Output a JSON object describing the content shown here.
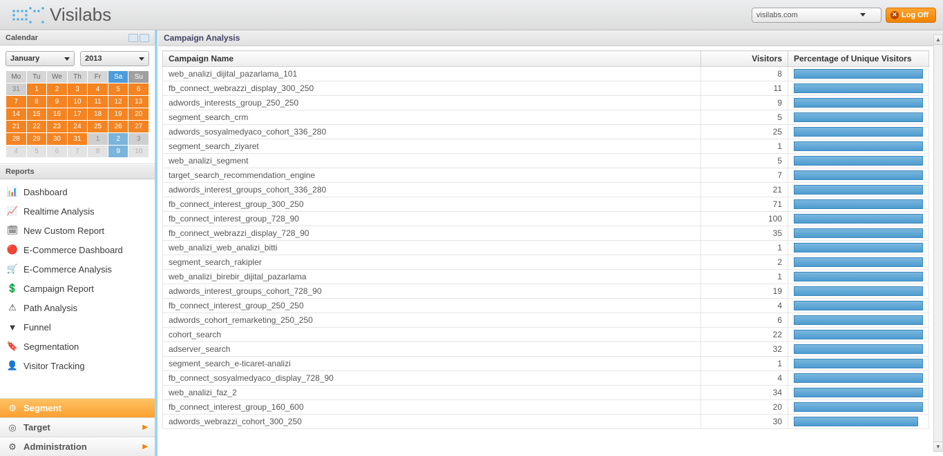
{
  "header": {
    "logo_text": "Visilabs",
    "domain": "visilabs.com",
    "logoff": "Log Off"
  },
  "sidebar": {
    "calendar_title": "Calendar",
    "month": "January",
    "year": "2013",
    "weekdays": [
      "Mo",
      "Tu",
      "We",
      "Th",
      "Fr",
      "Sa",
      "Su"
    ],
    "weeks": [
      [
        {
          "d": "31",
          "c": "gray"
        },
        {
          "d": "1",
          "c": "orange"
        },
        {
          "d": "2",
          "c": "orange"
        },
        {
          "d": "3",
          "c": "orange"
        },
        {
          "d": "4",
          "c": "orange"
        },
        {
          "d": "5",
          "c": "orange"
        },
        {
          "d": "6",
          "c": "orange"
        }
      ],
      [
        {
          "d": "7",
          "c": "orange"
        },
        {
          "d": "8",
          "c": "orange"
        },
        {
          "d": "9",
          "c": "orange"
        },
        {
          "d": "10",
          "c": "orange"
        },
        {
          "d": "11",
          "c": "orange"
        },
        {
          "d": "12",
          "c": "orange"
        },
        {
          "d": "13",
          "c": "orange"
        }
      ],
      [
        {
          "d": "14",
          "c": "orange"
        },
        {
          "d": "15",
          "c": "orange"
        },
        {
          "d": "16",
          "c": "orange"
        },
        {
          "d": "17",
          "c": "orange"
        },
        {
          "d": "18",
          "c": "orange"
        },
        {
          "d": "19",
          "c": "orange"
        },
        {
          "d": "20",
          "c": "orange"
        }
      ],
      [
        {
          "d": "21",
          "c": "orange"
        },
        {
          "d": "22",
          "c": "orange"
        },
        {
          "d": "23",
          "c": "orange"
        },
        {
          "d": "24",
          "c": "orange"
        },
        {
          "d": "25",
          "c": "orange"
        },
        {
          "d": "26",
          "c": "orange"
        },
        {
          "d": "27",
          "c": "orange"
        }
      ],
      [
        {
          "d": "28",
          "c": "orange"
        },
        {
          "d": "29",
          "c": "orange"
        },
        {
          "d": "30",
          "c": "orange"
        },
        {
          "d": "31",
          "c": "orange"
        },
        {
          "d": "1",
          "c": "gray"
        },
        {
          "d": "2",
          "c": "blue"
        },
        {
          "d": "3",
          "c": "gray"
        }
      ],
      [
        {
          "d": "4",
          "c": "faint"
        },
        {
          "d": "5",
          "c": "faint"
        },
        {
          "d": "6",
          "c": "faint"
        },
        {
          "d": "7",
          "c": "faint"
        },
        {
          "d": "8",
          "c": "faint"
        },
        {
          "d": "9",
          "c": "blue"
        },
        {
          "d": "10",
          "c": "faint"
        }
      ]
    ],
    "reports_title": "Reports",
    "reports": [
      {
        "label": "Dashboard",
        "icon": "bar-chart-icon"
      },
      {
        "label": "Realtime Analysis",
        "icon": "line-chart-icon"
      },
      {
        "label": "New Custom Report",
        "icon": "calendar-icon"
      },
      {
        "label": "E-Commerce Dashboard",
        "icon": "globe-icon"
      },
      {
        "label": "E-Commerce Analysis",
        "icon": "cart-icon"
      },
      {
        "label": "Campaign Report",
        "icon": "dollar-icon"
      },
      {
        "label": "Path Analysis",
        "icon": "warning-icon"
      },
      {
        "label": "Funnel",
        "icon": "funnel-icon"
      },
      {
        "label": "Segmentation",
        "icon": "tag-icon"
      },
      {
        "label": "Visitor Tracking",
        "icon": "user-icon"
      }
    ],
    "bottom": [
      {
        "label": "Segment",
        "icon": "gear-icon",
        "active": true,
        "arrow": false
      },
      {
        "label": "Target",
        "icon": "target-icon",
        "active": false,
        "arrow": true
      },
      {
        "label": "Administration",
        "icon": "admin-icon",
        "active": false,
        "arrow": true
      }
    ]
  },
  "main": {
    "title": "Campaign Analysis",
    "columns": {
      "name": "Campaign Name",
      "visitors": "Visitors",
      "percent": "Percentage of Unique Visitors"
    },
    "rows": [
      {
        "name": "web_analizi_dijital_pazarlama_101",
        "visitors": 8,
        "pct": 100
      },
      {
        "name": "fb_connect_webrazzi_display_300_250",
        "visitors": 11,
        "pct": 100
      },
      {
        "name": "adwords_interests_group_250_250",
        "visitors": 9,
        "pct": 100
      },
      {
        "name": "segment_search_crm",
        "visitors": 5,
        "pct": 100
      },
      {
        "name": "adwords_sosyalmedyaco_cohort_336_280",
        "visitors": 25,
        "pct": 100
      },
      {
        "name": "segment_search_ziyaret",
        "visitors": 1,
        "pct": 100
      },
      {
        "name": "web_analizi_segment",
        "visitors": 5,
        "pct": 100
      },
      {
        "name": "target_search_recommendation_engine",
        "visitors": 7,
        "pct": 100
      },
      {
        "name": "adwords_interest_groups_cohort_336_280",
        "visitors": 21,
        "pct": 100
      },
      {
        "name": "fb_connect_interest_group_300_250",
        "visitors": 71,
        "pct": 100
      },
      {
        "name": "fb_connect_interest_group_728_90",
        "visitors": 100,
        "pct": 100
      },
      {
        "name": "fb_connect_webrazzi_display_728_90",
        "visitors": 35,
        "pct": 100
      },
      {
        "name": "web_analizi_web_analizi_bitti",
        "visitors": 1,
        "pct": 100
      },
      {
        "name": "segment_search_rakipler",
        "visitors": 2,
        "pct": 100
      },
      {
        "name": "web_analizi_birebir_dijital_pazarlama",
        "visitors": 1,
        "pct": 100
      },
      {
        "name": "adwords_interest_groups_cohort_728_90",
        "visitors": 19,
        "pct": 100
      },
      {
        "name": "fb_connect_interest_group_250_250",
        "visitors": 4,
        "pct": 100
      },
      {
        "name": "adwords_cohort_remarketing_250_250",
        "visitors": 6,
        "pct": 100
      },
      {
        "name": "cohort_search",
        "visitors": 22,
        "pct": 100
      },
      {
        "name": "adserver_search",
        "visitors": 32,
        "pct": 100
      },
      {
        "name": "segment_search_e-ticaret-analizi",
        "visitors": 1,
        "pct": 100
      },
      {
        "name": "fb_connect_sosyalmedyaco_display_728_90",
        "visitors": 4,
        "pct": 100
      },
      {
        "name": "web_analizi_faz_2",
        "visitors": 34,
        "pct": 100
      },
      {
        "name": "fb_connect_interest_group_160_600",
        "visitors": 20,
        "pct": 100
      },
      {
        "name": "adwords_webrazzi_cohort_300_250",
        "visitors": 30,
        "pct": 96
      }
    ]
  }
}
